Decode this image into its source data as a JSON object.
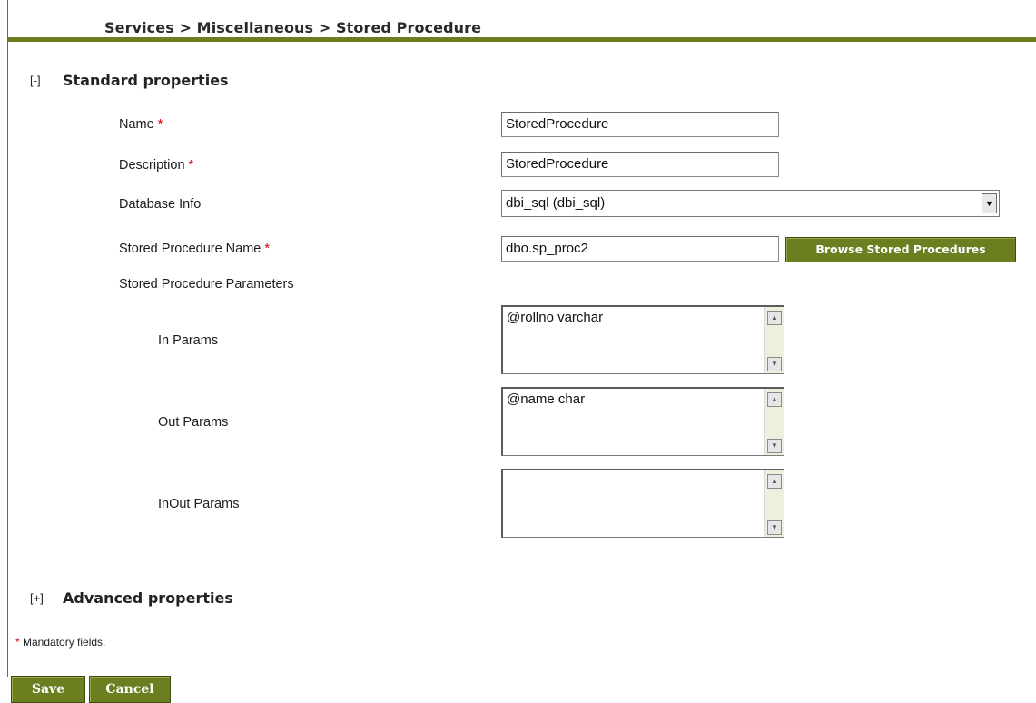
{
  "breadcrumb": "Services > Miscellaneous > Stored Procedure",
  "standard": {
    "toggle": "[-]",
    "title": "Standard properties",
    "fields": {
      "name": {
        "label": "Name",
        "value": "StoredProcedure"
      },
      "description": {
        "label": "Description",
        "value": "StoredProcedure"
      },
      "database_info": {
        "label": "Database Info",
        "value": "dbi_sql (dbi_sql)"
      },
      "sp_name": {
        "label": "Stored Procedure Name",
        "value": "dbo.sp_proc2"
      }
    },
    "required_marker": "*",
    "browse_button": "Browse Stored Procedures",
    "parameters_label": "Stored Procedure Parameters",
    "params": {
      "in": {
        "label": "In Params",
        "value": "@rollno varchar"
      },
      "out": {
        "label": "Out Params",
        "value": "@name char"
      },
      "inout": {
        "label": "InOut Params",
        "value": ""
      }
    }
  },
  "advanced": {
    "toggle": "[+]",
    "title": "Advanced properties"
  },
  "mandatory_note": "Mandatory fields.",
  "buttons": {
    "save": "Save",
    "cancel": "Cancel"
  },
  "colors": {
    "accent": "#6b7f21",
    "required": "#d00000"
  }
}
